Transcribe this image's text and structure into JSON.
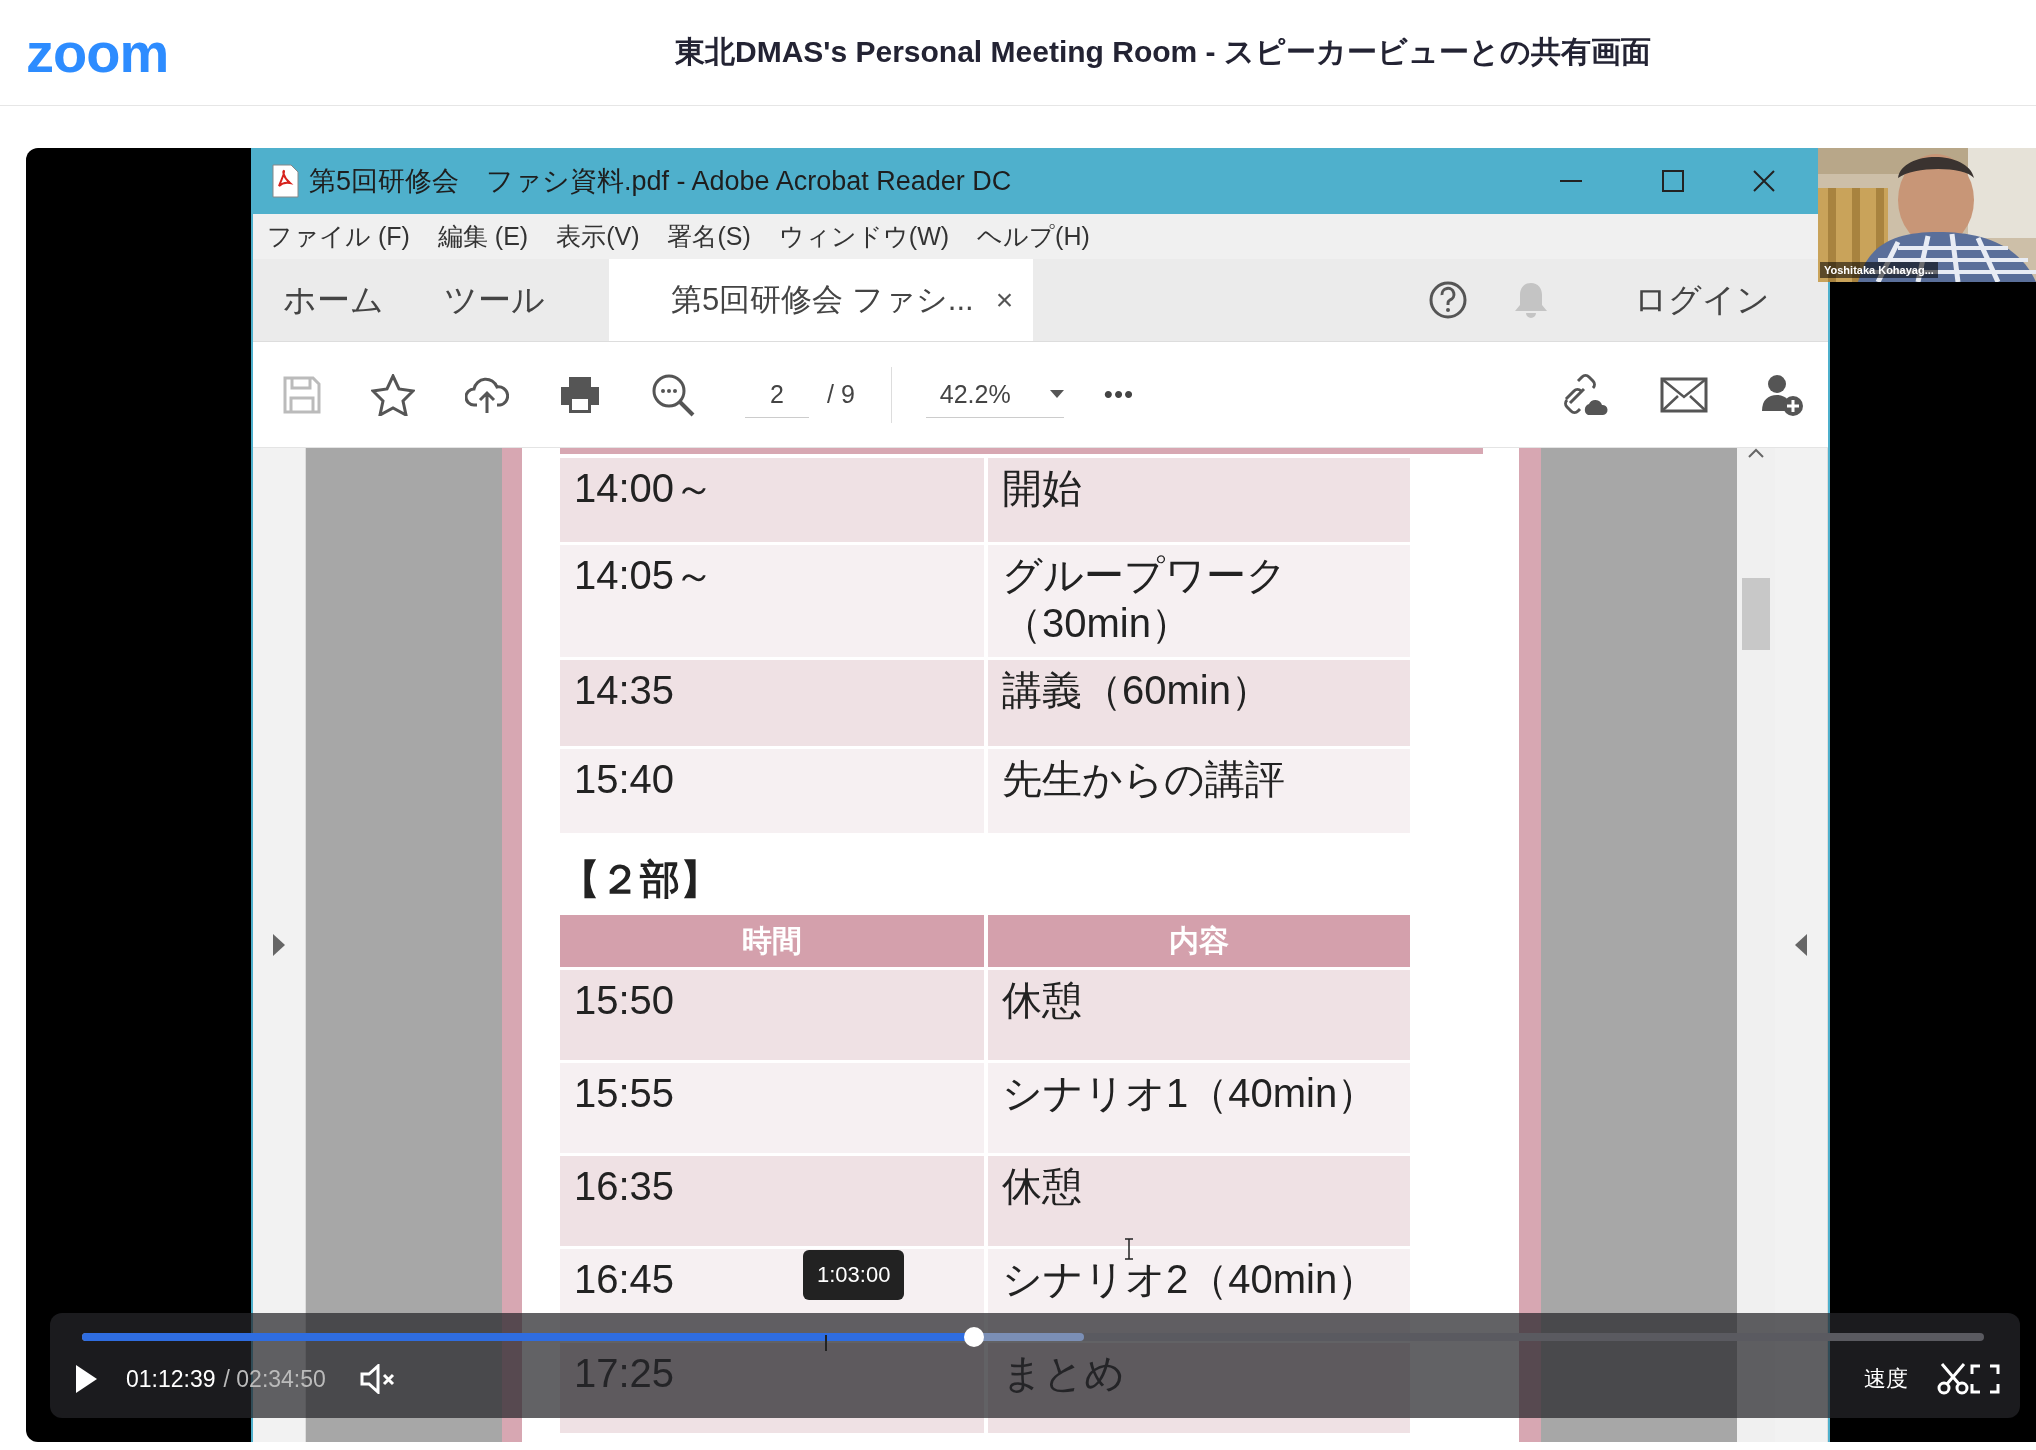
{
  "app": {
    "logo": "zoom",
    "title": "東北DMAS's Personal Meeting Room - スピーカービューとの共有画面"
  },
  "shared_window": {
    "title": "第5回研修会　ファシ資料.pdf - Adobe Acrobat Reader DC",
    "menu": [
      "ファイル (F)",
      "編集 (E)",
      "表示(V)",
      "署名(S)",
      "ウィンドウ(W)",
      "ヘルプ(H)"
    ],
    "tabs": [
      {
        "label": "ホーム",
        "selected": false
      },
      {
        "label": "ツール",
        "selected": false
      },
      {
        "label": "第5回研修会  ファシ...",
        "selected": true
      }
    ],
    "tab_close": "×",
    "login": "ログイン",
    "page_current": "2",
    "page_total": "/ 9",
    "zoom": "42.2%",
    "more": "•••"
  },
  "document": {
    "part1_rows": [
      {
        "time": "14:00～",
        "content": "開始"
      },
      {
        "time": "14:05～",
        "content": "グループワーク（30min）"
      },
      {
        "time": "14:35",
        "content": "講義（60min）"
      },
      {
        "time": "15:40",
        "content": "先生からの講評"
      }
    ],
    "part2_heading": "【２部】",
    "columns": [
      "時間",
      "内容"
    ],
    "part2_rows": [
      {
        "time": "15:50",
        "content": "休憩"
      },
      {
        "time": "15:55",
        "content": "シナリオ1（40min）"
      },
      {
        "time": "16:35",
        "content": "休憩"
      },
      {
        "time": "16:45",
        "content": "シナリオ2（40min）"
      },
      {
        "time": "17:25",
        "content": "まとめ"
      }
    ]
  },
  "speaker": {
    "name": "Yoshitaka Kohayag..."
  },
  "player": {
    "tooltip": "1:03:00",
    "level": 0.469,
    "elapsed": "01:12:39",
    "total": "/ 02:34:50",
    "muted": true,
    "speed": "速度"
  }
}
